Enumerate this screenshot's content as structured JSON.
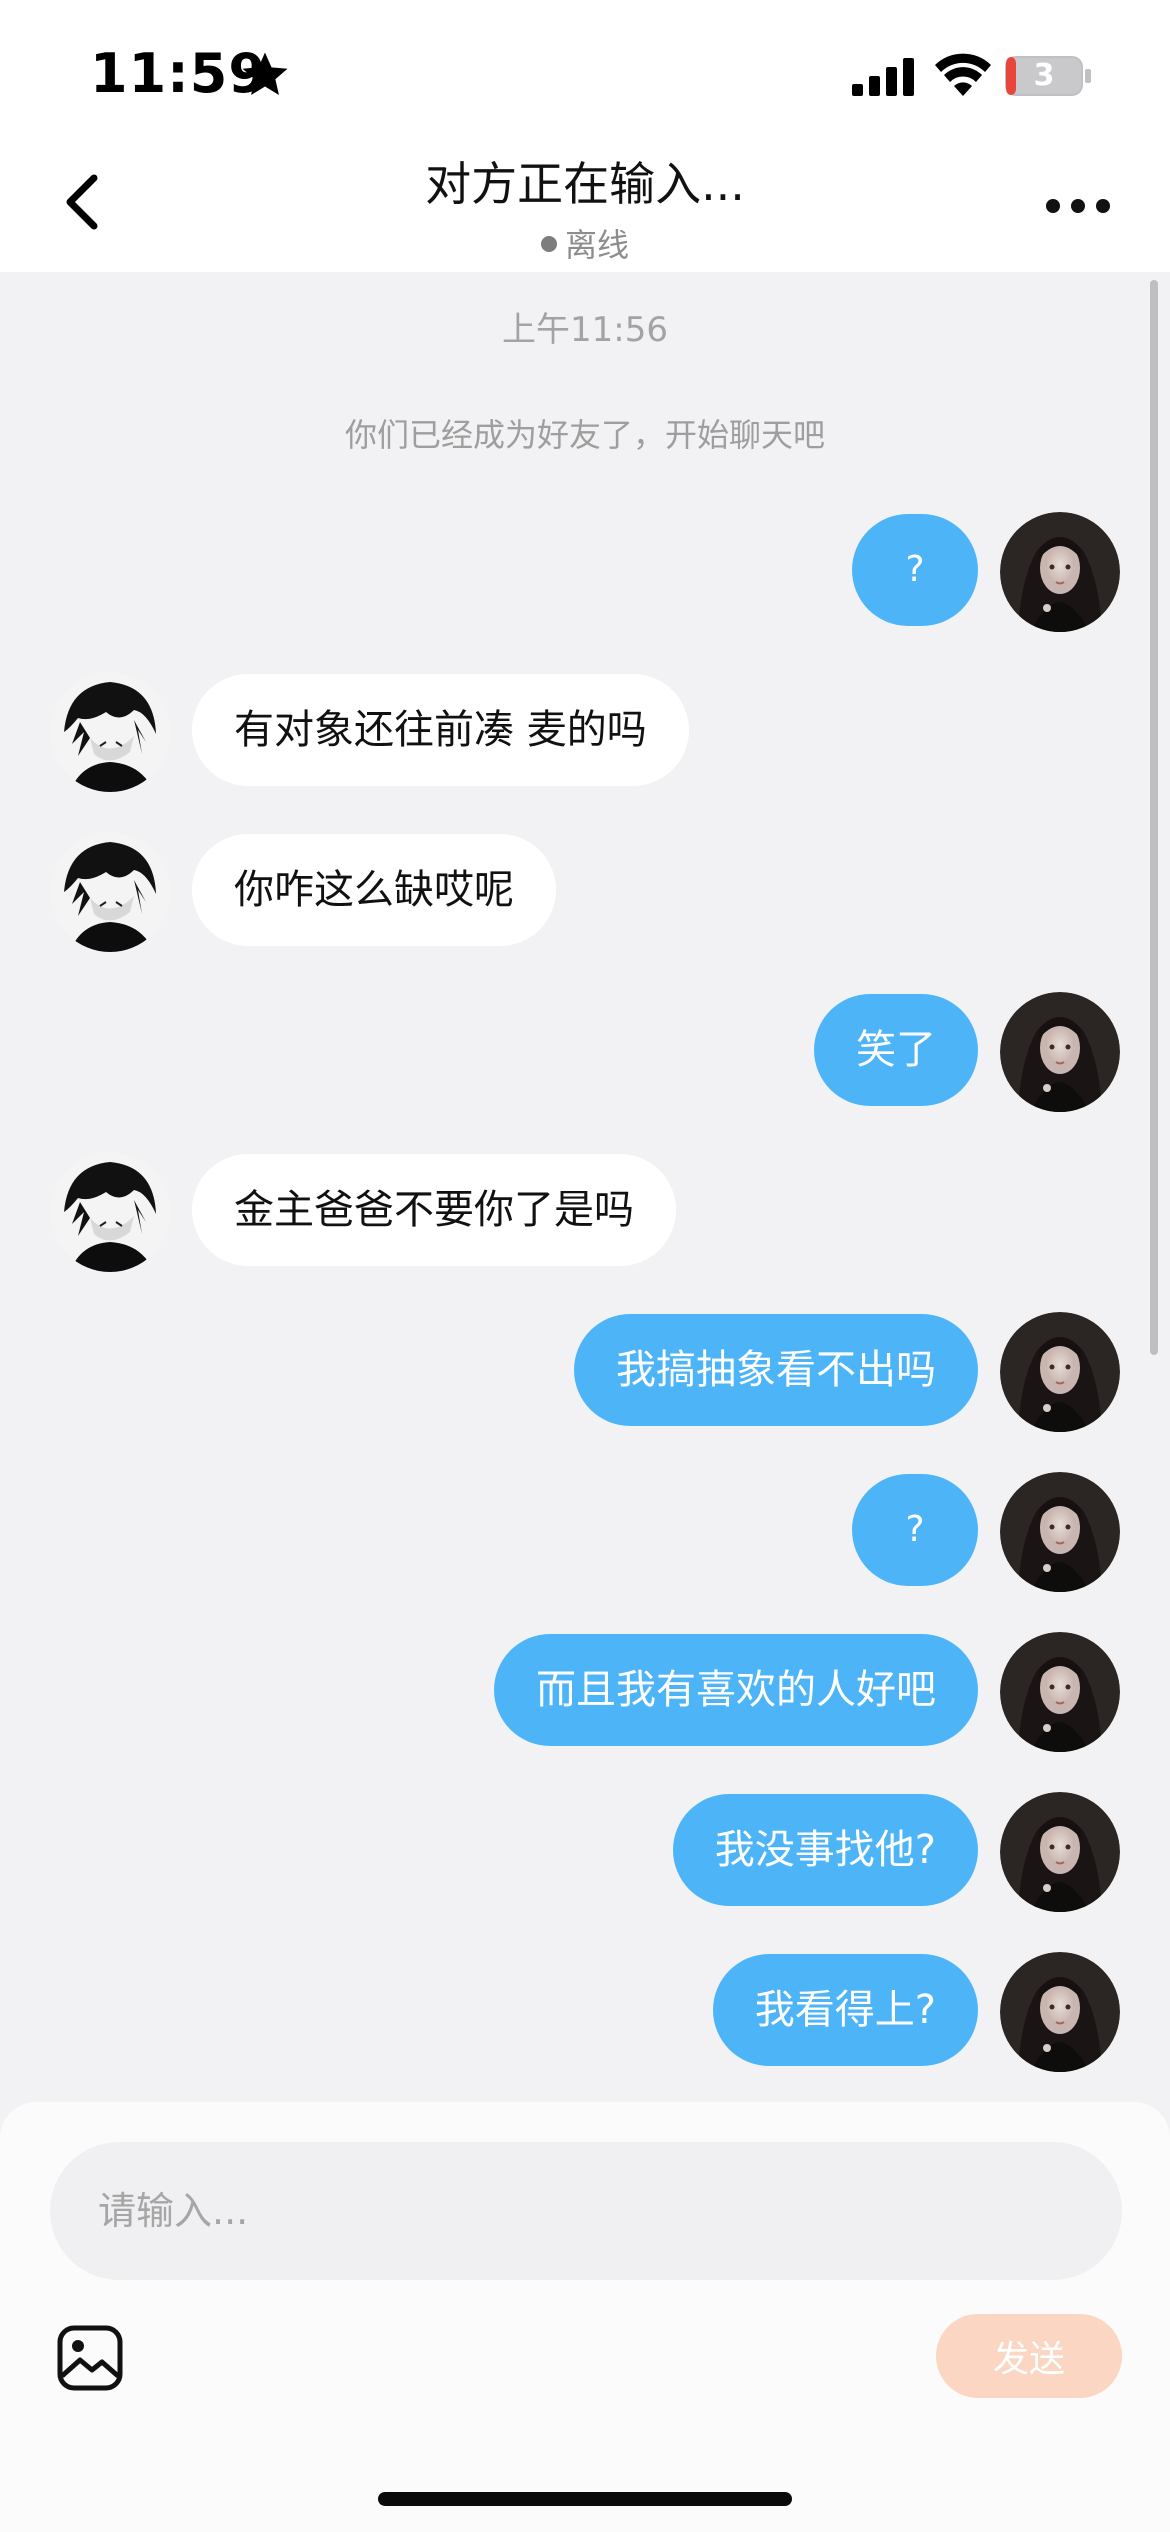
{
  "status_bar": {
    "time": "11:59",
    "battery_level": "3",
    "icons": [
      "star-icon",
      "signal-icon",
      "wifi-icon",
      "battery-icon"
    ]
  },
  "header": {
    "title": "对方正在输入...",
    "status": "离线",
    "back_icon": "chevron-left-icon",
    "more_icon": "more-horizontal-icon"
  },
  "chat": {
    "timestamp": "上午11:56",
    "system_message": "你们已经成为好友了，开始聊天吧",
    "messages": [
      {
        "side": "outgoing",
        "text": "?"
      },
      {
        "side": "incoming",
        "text": "有对象还往前凑 麦的吗"
      },
      {
        "side": "incoming",
        "text": "你咋这么缺哎呢"
      },
      {
        "side": "outgoing",
        "text": "笑了"
      },
      {
        "side": "incoming",
        "text": "金主爸爸不要你了是吗"
      },
      {
        "side": "outgoing",
        "text": "我搞抽象看不出吗"
      },
      {
        "side": "outgoing",
        "text": "?"
      },
      {
        "side": "outgoing",
        "text": "而且我有喜欢的人好吧"
      },
      {
        "side": "outgoing",
        "text": "我没事找他?"
      },
      {
        "side": "outgoing",
        "text": "我看得上?"
      }
    ]
  },
  "composer": {
    "placeholder": "请输入...",
    "send_label": "发送",
    "image_icon": "image-icon"
  },
  "colors": {
    "outgoing_bubble": "#4db4f8",
    "incoming_bubble": "#ffffff",
    "send_button": "#fbd6c2",
    "background": "#f2f2f4"
  }
}
